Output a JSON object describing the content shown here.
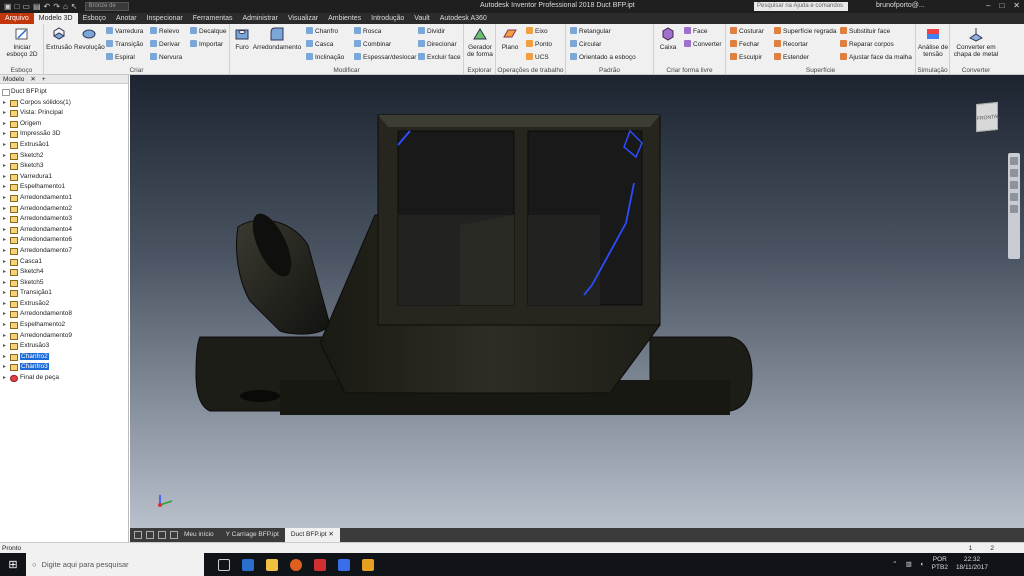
{
  "window": {
    "title": "Autodesk Inventor Professional 2018   Duct BFP.ipt",
    "material": "Bronze de",
    "search_placeholder": "Pesquisar na Ajuda e comandos",
    "user": "brunofporto@..."
  },
  "menu_tabs": [
    "Arquivo",
    "Modelo 3D",
    "Esboço",
    "Anotar",
    "Inspecionar",
    "Ferramentas",
    "Administrar",
    "Visualizar",
    "Ambientes",
    "Introdução",
    "Vault",
    "Autodesk A360"
  ],
  "ribbon": {
    "esboco": {
      "label": "Esboço",
      "start_sketch": "Iniciar esboço 2D"
    },
    "criar": {
      "label": "Criar",
      "extrusao": "Extrusão",
      "revolucao": "Revolução",
      "varredura": "Varredura",
      "transicao": "Transição",
      "espiral": "Espiral",
      "relevo": "Relevo",
      "derivar": "Derivar",
      "nervura": "Nervura",
      "decalque": "Decalque",
      "importar": "Importar"
    },
    "modificar": {
      "label": "Modificar",
      "furo": "Furo",
      "arredondamento": "Arredondamento",
      "chanfro": "Chanfro",
      "casca": "Casca",
      "inclinacao": "Inclinação",
      "rosca": "Rosca",
      "combinar": "Combinar",
      "espessar": "Espessar/deslocar",
      "dividir": "Dividir",
      "direcionar": "Direcionar",
      "excluir_face": "Excluir face"
    },
    "explorar": {
      "label": "Explorar",
      "gerador": "Gerador de forma"
    },
    "operacoes": {
      "label": "Operações de trabalho",
      "plano": "Plano",
      "eixo": "Eixo",
      "ponto": "Ponto",
      "ucs": "UCS"
    },
    "padrao": {
      "label": "Padrão",
      "retangular": "Retangular",
      "circular": "Circular",
      "orientado": "Orientado a esboço"
    },
    "forma_livre": {
      "label": "Criar forma livre",
      "caixa": "Caixa",
      "face": "Face",
      "converter": "Converter"
    },
    "superficie": {
      "label": "Superfície",
      "costurar": "Costurar",
      "fechar": "Fechar",
      "esculpir": "Esculpir",
      "regrada": "Superfície regrada",
      "recortar": "Recortar",
      "estender": "Estender",
      "substituir": "Substituir face",
      "reparar": "Reparar corpos",
      "ajustar": "Ajustar face da malha"
    },
    "simulacao": {
      "label": "Simulação",
      "analise": "Análise de tensão"
    },
    "converter": {
      "label": "Converter",
      "chapa": "Converter em chapa de metal"
    }
  },
  "browser": {
    "tab": "Modelo",
    "root": "Duct BFP.ipt",
    "nodes": [
      "Corpos sólidos(1)",
      "Vista: Principal",
      "Origem",
      "Impressão 3D",
      "Extrusão1",
      "Sketch2",
      "Sketch3",
      "Varredura1",
      "Espelhamento1",
      "Arredondamento1",
      "Arredondamento2",
      "Arredondamento3",
      "Arredondamento4",
      "Arredondamento6",
      "Arredondamento7",
      "Casca1",
      "Sketch4",
      "Sketch5",
      "Transição1",
      "Extrusão2",
      "Arredondamento8",
      "Espelhamento2",
      "Arredondamento9",
      "Extrusão3",
      "Chanfro2",
      "Chanfro3",
      "Final de peça"
    ]
  },
  "viewcube_label": "FRONTAL",
  "doc_tabs": [
    "Meu início",
    "Y Carriage BFP.ipt",
    "Duct BFP.ipt"
  ],
  "status": {
    "text": "Pronto",
    "page1": "1",
    "page2": "2"
  },
  "taskbar": {
    "search": "Digite aqui para pesquisar",
    "lang1": "POR",
    "lang2": "PTB2",
    "time": "22:32",
    "date": "18/11/2017"
  },
  "colors": {
    "file_tab": "#c2360d",
    "selection": "#1e6ad6",
    "edge_highlight": "#2a4dff"
  }
}
